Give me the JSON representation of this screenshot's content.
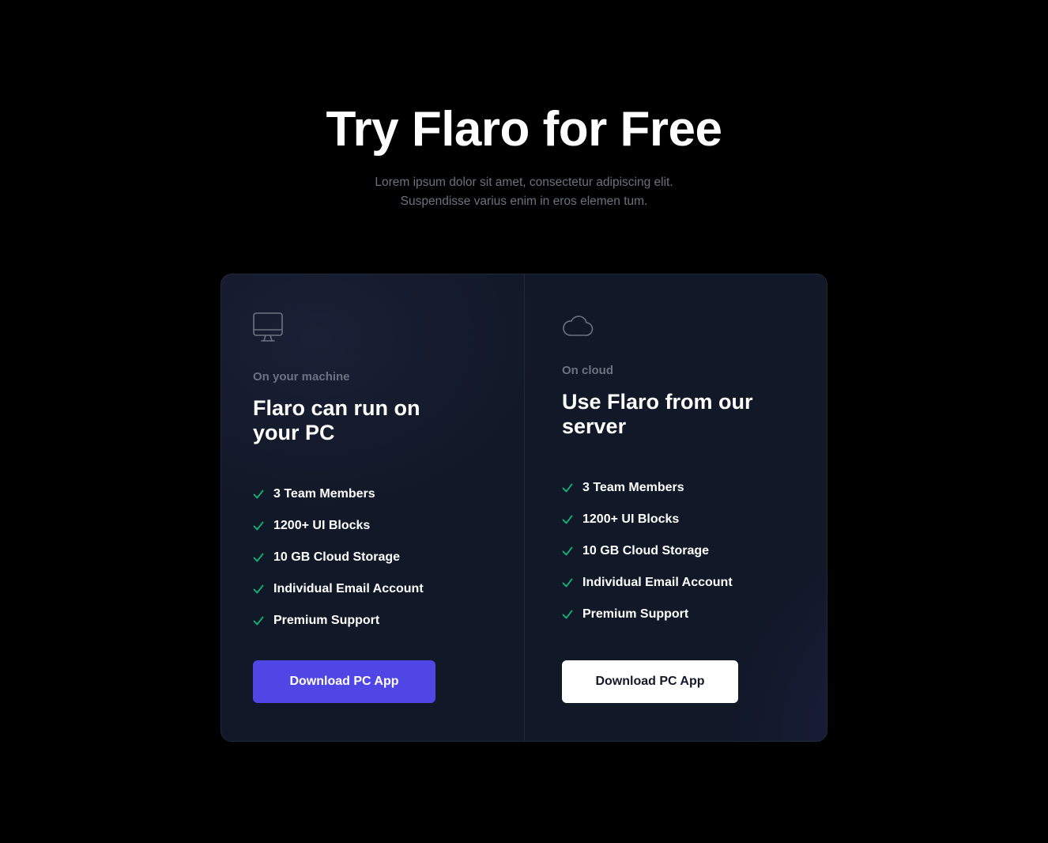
{
  "hero": {
    "title": "Try Flaro for Free",
    "subtitle_line1": "Lorem ipsum dolor sit amet, consectetur adipiscing elit.",
    "subtitle_line2": "Suspendisse varius enim in eros elemen tum."
  },
  "colors": {
    "background": "#000000",
    "card": "#111827",
    "accent": "#4f46e5",
    "check": "#10b981",
    "muted_text": "#6b7280"
  },
  "options": [
    {
      "icon": "monitor-icon",
      "eyebrow": "On your machine",
      "title": "Flaro can run on your PC",
      "features": [
        "3 Team Members",
        "1200+ UI Blocks",
        "10 GB Cloud Storage",
        "Individual Email Account",
        "Premium Support"
      ],
      "button_label": "Download PC App"
    },
    {
      "icon": "cloud-icon",
      "eyebrow": "On cloud",
      "title": "Use Flaro from our server",
      "features": [
        "3 Team Members",
        "1200+ UI Blocks",
        "10 GB Cloud Storage",
        "Individual Email Account",
        "Premium Support"
      ],
      "button_label": "Download PC App"
    }
  ]
}
